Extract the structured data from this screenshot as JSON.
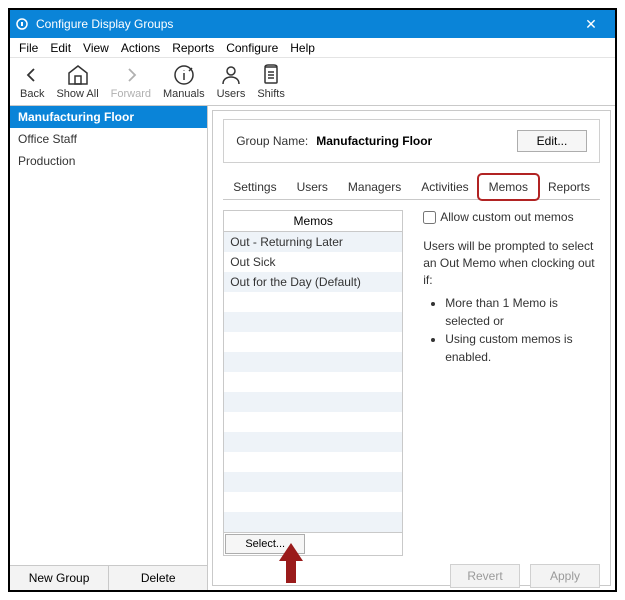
{
  "window": {
    "title": "Configure Display Groups",
    "close": "✕"
  },
  "menubar": [
    "File",
    "Edit",
    "View",
    "Actions",
    "Reports",
    "Configure",
    "Help"
  ],
  "toolbar": {
    "back": "Back",
    "showall": "Show All",
    "forward": "Forward",
    "manuals": "Manuals",
    "users": "Users",
    "shifts": "Shifts"
  },
  "sidebar": {
    "groups": [
      {
        "name": "Manufacturing Floor",
        "selected": true
      },
      {
        "name": "Office Staff",
        "selected": false
      },
      {
        "name": "Production",
        "selected": false
      }
    ],
    "newgroup": "New Group",
    "delete": "Delete"
  },
  "content": {
    "groupname_label": "Group Name:",
    "groupname_value": "Manufacturing Floor",
    "edit": "Edit...",
    "tabs": [
      "Settings",
      "Users",
      "Managers",
      "Activities",
      "Memos",
      "Reports"
    ],
    "active_tab": "Memos",
    "memos_header": "Memos",
    "memos": [
      "Out - Returning Later",
      "Out Sick",
      "Out for the Day (Default)"
    ],
    "select": "Select...",
    "allow_custom": "Allow custom out memos",
    "prompt_text": "Users will be prompted to select an Out Memo when clocking out if:",
    "bullets": [
      "More than 1 Memo is selected or",
      "Using custom memos is enabled."
    ],
    "revert": "Revert",
    "apply": "Apply"
  }
}
